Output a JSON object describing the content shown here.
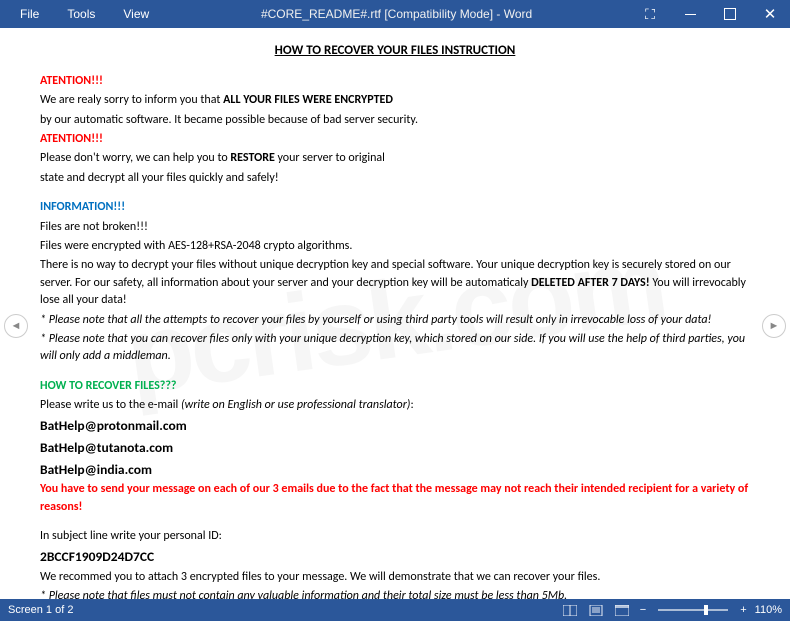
{
  "menu": {
    "file": "File",
    "tools": "Tools",
    "view": "View"
  },
  "title": "#CORE_README#.rtf [Compatibility Mode] - Word",
  "doc": {
    "heading": "HOW TO RECOVER YOUR FILES INSTRUCTION",
    "atention1": "ATENTION!!!",
    "l1a": "We are realy sorry to inform you that    ",
    "l1b": "ALL YOUR FILES WERE ENCRYPTED",
    "l2": "by our automatic software. It became possible because of bad server security.",
    "atention2": "ATENTION!!!",
    "l3a": "Please don't worry, we can help you to ",
    "l3b": "RESTORE",
    "l3c": " your server to original",
    "l4": "state and decrypt all your files quickly and safely!",
    "info_h": "INFORMATION!!!",
    "i1": "Files are not broken!!!",
    "i2": "Files were encrypted with AES-128+RSA-2048 crypto algorithms.",
    "i3a": "There is no way to decrypt your files without unique decryption key and special software. Your unique decryption key is securely stored on our server. For our safety, all information about your server and your decryption key will be automaticaly ",
    "i3b": "DELETED AFTER 7 DAYS!",
    "i3c": " You will irrevocably lose all your data!",
    "n1": "* Please note that all the attempts to recover your files by yourself or using third party tools will result only in irrevocable loss of your data!",
    "n2": "* Please note that you can recover files only with your unique decryption key, which stored on our side. If you will use the help of third parties, you will only add a middleman.",
    "howto_h": "HOW TO RECOVER FILES???",
    "h1a": "Please write us to the e-mail ",
    "h1b": "(write on English or use professional translator)",
    "h1c": ":",
    "email1": "BatHelp@protonmail.com",
    "email2": "BatHelp@tutanota.com",
    "email3": "BatHelp@india.com",
    "warn3": "You have to send your message on each of our 3 emails due to the fact that the message may not reach their intended recipient for a variety of reasons!",
    "subj": "In subject line write your personal ID:",
    "pid": "2BCCF1909D24D7CC",
    "rec": "We recommed you to attach 3 encrypted files to your message. We will demonstrate that we can recover your files.",
    "note5": "*      Please note that files must not contain any valuable information and their total size must be less than 5Mb."
  },
  "status": {
    "screen": "Screen 1 of 2",
    "zoom": "110%",
    "minus": "−",
    "plus": "+"
  },
  "watermark": "pcrisk.com"
}
